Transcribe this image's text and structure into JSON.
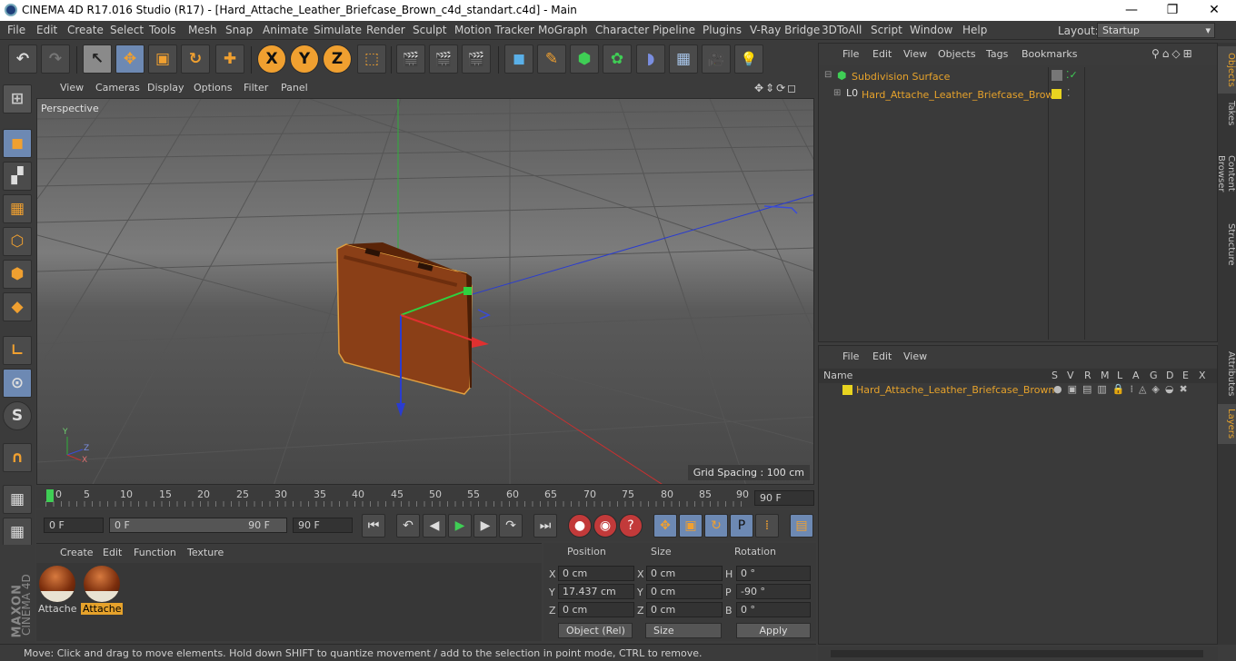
{
  "window": {
    "title": "CINEMA 4D R17.016 Studio (R17) - [Hard_Attache_Leather_Briefcase_Brown_c4d_standart.c4d] - Main",
    "minimize": "—",
    "maximize": "❐",
    "close": "✕"
  },
  "menu": {
    "items": [
      "File",
      "Edit",
      "Create",
      "Select",
      "Tools",
      "Mesh",
      "Snap",
      "Animate",
      "Simulate",
      "Render",
      "Sculpt",
      "Motion Tracker",
      "MoGraph",
      "Character",
      "Pipeline",
      "Plugins",
      "V-Ray Bridge",
      "3DToAll",
      "Script",
      "Window",
      "Help"
    ],
    "layout_label": "Layout:",
    "layout_value": "Startup"
  },
  "toolbar": {
    "undo": "↶",
    "redo": "↷",
    "select": "↖",
    "move": "✥",
    "scale": "▣",
    "rotate": "↻",
    "add": "✚",
    "axis_x": "X",
    "axis_y": "Y",
    "axis_z": "Z",
    "coord": "⬚",
    "render_view": "🎬",
    "render_pic": "🎬",
    "render_settings": "🎬",
    "cube": "◼",
    "pen": "✎",
    "subdiv": "⬢",
    "array": "✿",
    "deformer": "◗",
    "floor": "▦",
    "camera": "🎥",
    "light": "💡"
  },
  "viewport": {
    "menu": [
      "View",
      "Cameras",
      "Display",
      "Options",
      "Filter",
      "Panel"
    ],
    "label": "Perspective",
    "grid_spacing": "Grid Spacing : 100 cm",
    "axis_y": "Y",
    "axis_z": "Z",
    "axis_x": "X"
  },
  "timeline": {
    "ticks": [
      "0",
      "5",
      "10",
      "15",
      "20",
      "25",
      "30",
      "35",
      "40",
      "45",
      "50",
      "55",
      "60",
      "65",
      "70",
      "75",
      "80",
      "85",
      "90"
    ],
    "current_frame": "90 F"
  },
  "transport": {
    "start": "0 F",
    "slider_left": "0 F",
    "slider_right": "90 F",
    "end": "90 F"
  },
  "materials": {
    "menu": [
      "Create",
      "Edit",
      "Function",
      "Texture"
    ],
    "items": [
      {
        "label": "Attache"
      },
      {
        "label": "Attache"
      }
    ]
  },
  "coords": {
    "headers": {
      "position": "Position",
      "size": "Size",
      "rotation": "Rotation"
    },
    "pos": {
      "x": "0 cm",
      "y": "17.437 cm",
      "z": "0 cm"
    },
    "size": {
      "x": "0 cm",
      "y": "0 cm",
      "z": "0 cm"
    },
    "rot": {
      "h": "0 °",
      "p": "-90 °",
      "b": "0 °"
    },
    "axis": {
      "x": "X",
      "y": "Y",
      "z": "Z",
      "h": "H",
      "p": "P",
      "b": "B"
    },
    "mode": "Object (Rel)",
    "size_mode": "Size",
    "apply": "Apply"
  },
  "status": "Move: Click and drag to move elements. Hold down SHIFT to quantize movement / add to the selection in point mode, CTRL to remove.",
  "brand": {
    "line1": "MAXON",
    "line2": "CINEMA 4D"
  },
  "objects": {
    "menu": [
      "File",
      "Edit",
      "View",
      "Objects",
      "Tags",
      "Bookmarks"
    ],
    "rows": [
      {
        "name": "Subdivision Surface"
      },
      {
        "name": "Hard_Attache_Leather_Briefcase_Brown"
      }
    ]
  },
  "layers": {
    "menu": [
      "File",
      "Edit",
      "View"
    ],
    "columns": [
      "Name",
      "S",
      "V",
      "R",
      "M",
      "L",
      "A",
      "G",
      "D",
      "E",
      "X"
    ],
    "row": "Hard_Attache_Leather_Briefcase_Brown"
  },
  "side_tabs": [
    "Objects",
    "Takes",
    "Content Browser",
    "Structure",
    "Attributes",
    "Layers"
  ],
  "colors": {
    "accent": "#e6a22b",
    "selected_blue": "#6d89b3",
    "layer_yellow": "#e8d420"
  }
}
